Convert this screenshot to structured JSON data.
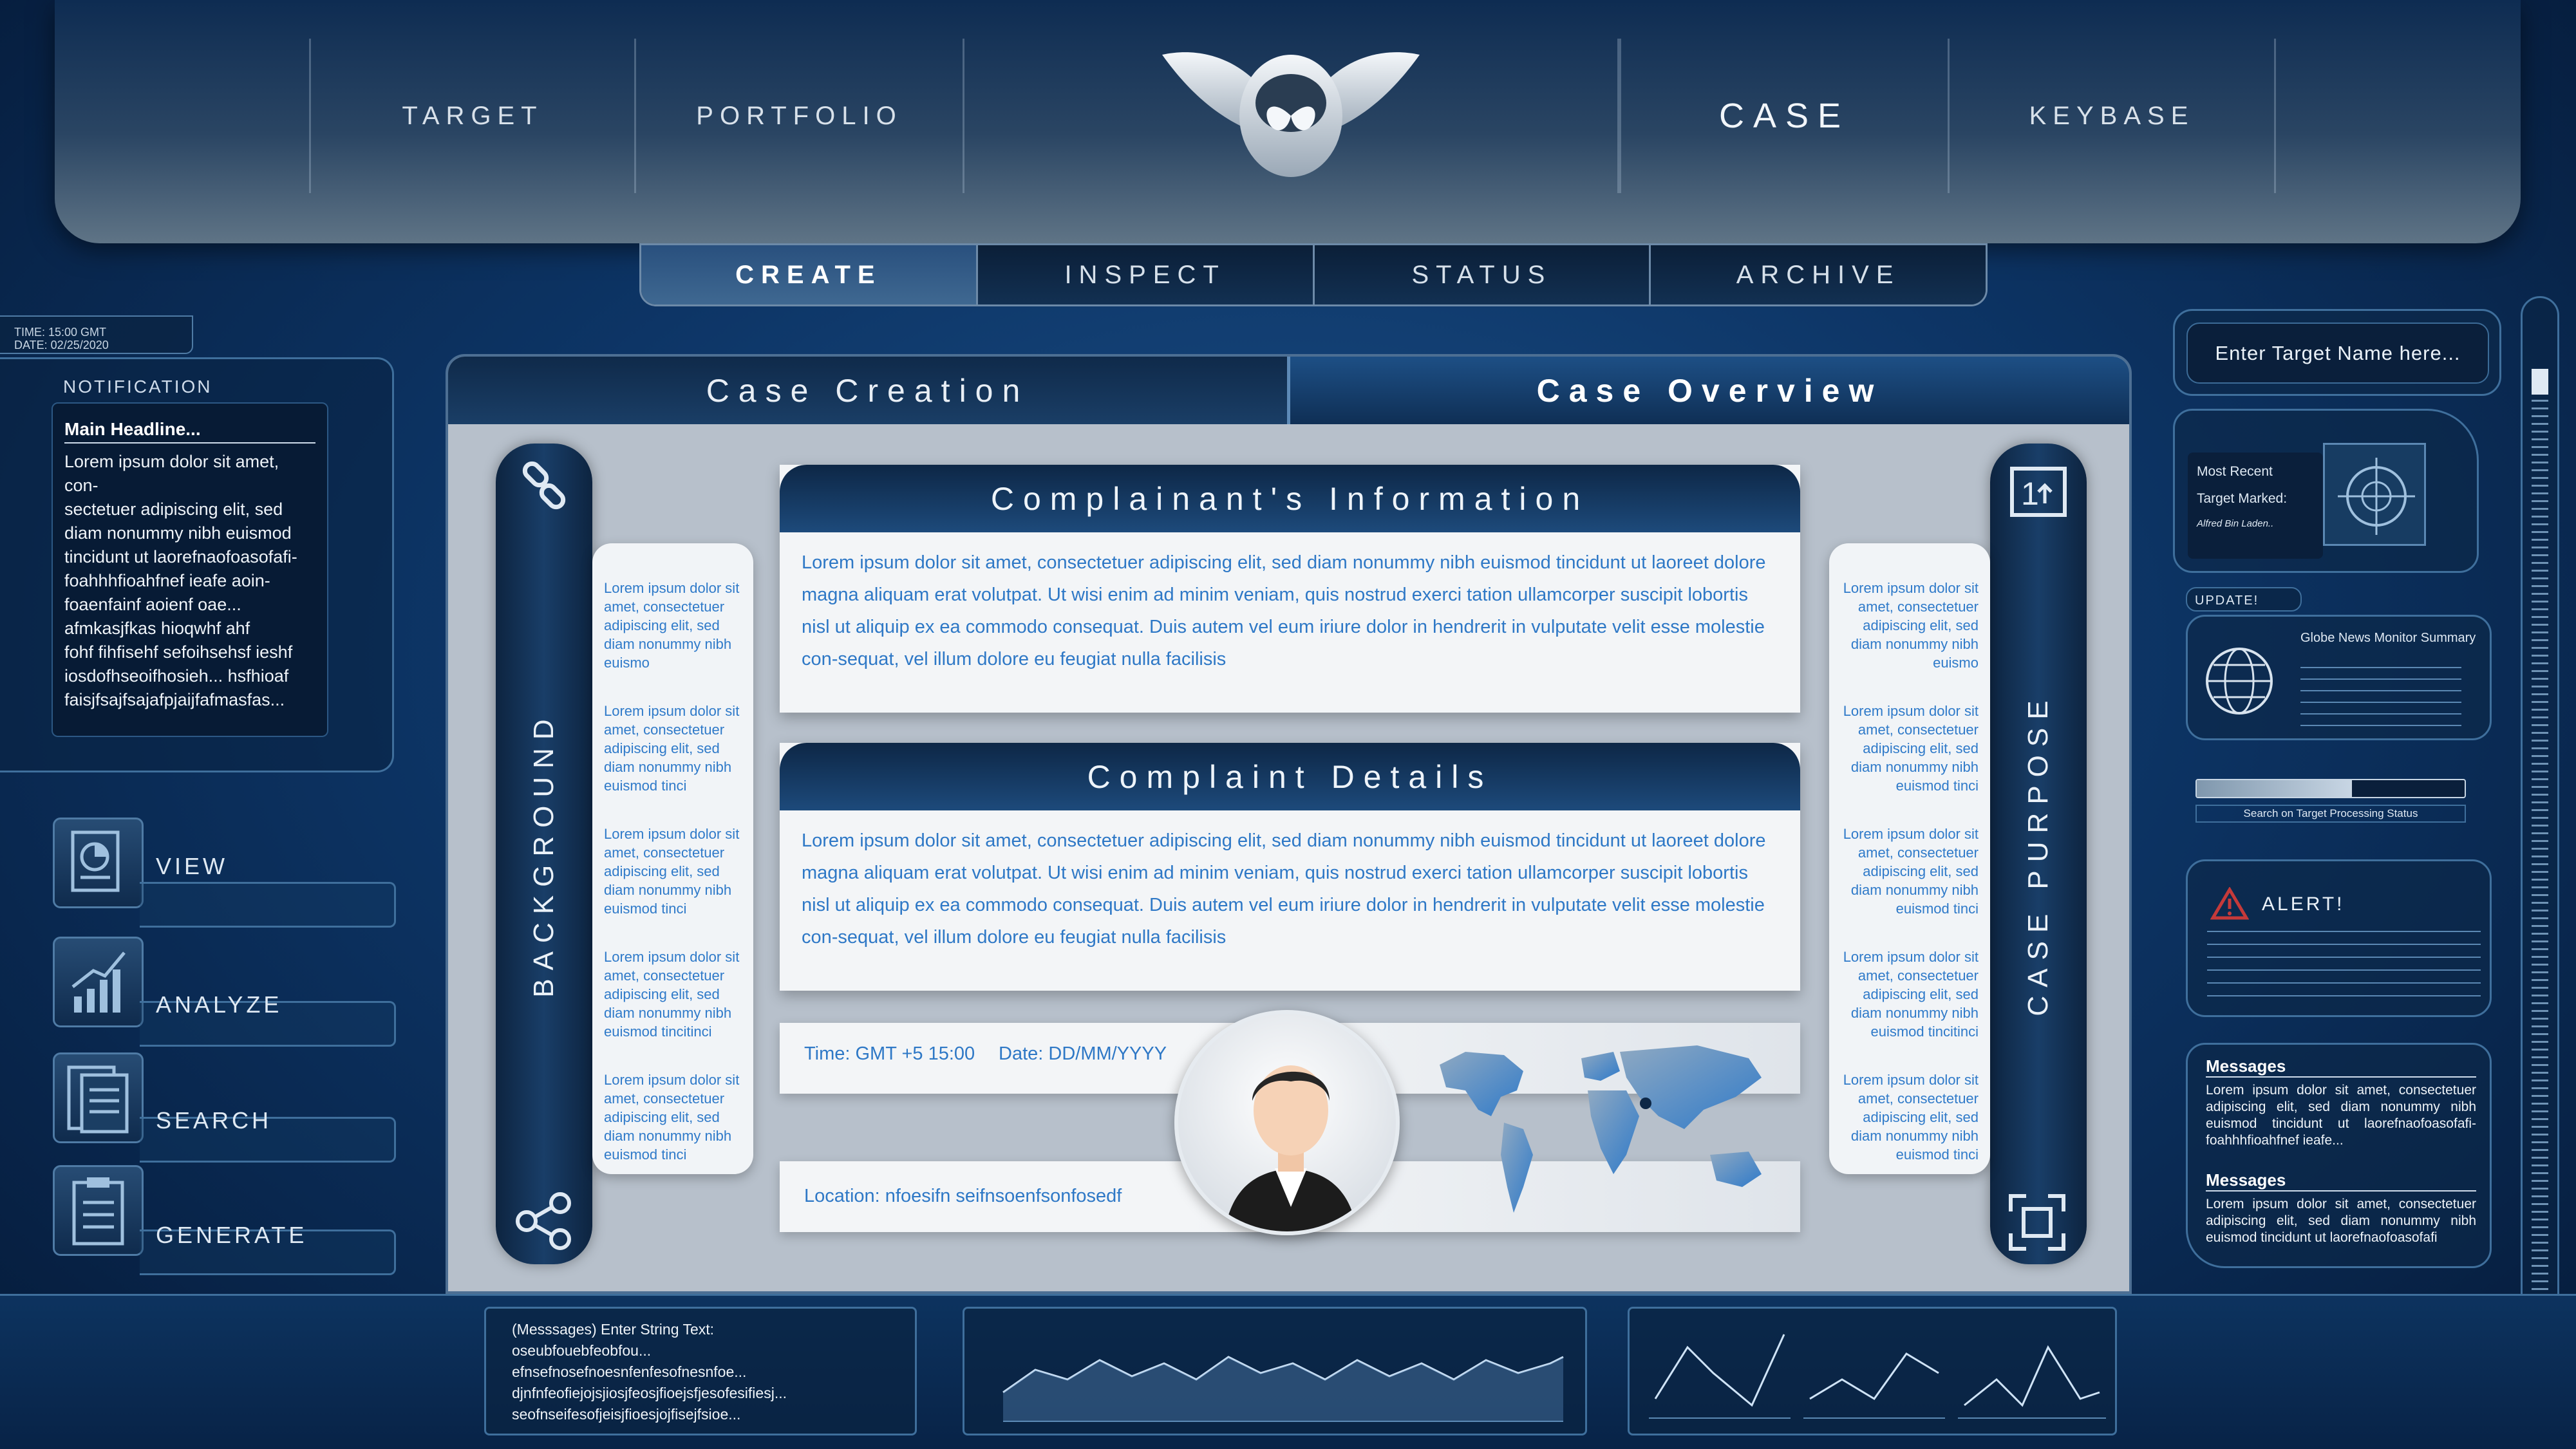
{
  "top_nav": {
    "items": [
      "TARGET",
      "PORTFOLIO",
      "CASE",
      "KEYBASE"
    ],
    "logo": "winged-owl-logo"
  },
  "sub_tabs": {
    "create": "CREATE",
    "inspect": "INSPECT",
    "status": "STATUS",
    "archive": "ARCHIVE",
    "active": "CREATE"
  },
  "time_box": {
    "time": "TIME: 15:00 GMT",
    "date": "DATE: 02/25/2020"
  },
  "notification": {
    "title": "NOTIFICATION",
    "headline": "Main Headline...",
    "lines": [
      "Lorem ipsum dolor sit amet, con-",
      "sectetuer adipiscing elit, sed",
      "diam nonummy nibh euismod",
      "tincidunt ut laorefnaofoasofafi-",
      "foahhhfioahfnef ieafe aoin-",
      "foaenfainf aoienf oae...",
      "afmkasjfkas hioqwhf ahf",
      "fohf fihfisehf sefoihsehsf ieshf",
      "iosdofhseoifhosieh... hsfhioaf",
      "faisjfsajfsajafpjaijfafmasfas..."
    ]
  },
  "left_actions": {
    "view": "VIEW",
    "analyze": "ANALYZE",
    "search": "SEARCH",
    "generate": "GENERATE"
  },
  "panel_tabs": {
    "creation": "Case Creation",
    "overview": "Case Overview",
    "active": "Case Overview"
  },
  "side_labels": {
    "left": "BACKGROUND",
    "right": "CASE PURPOSE"
  },
  "lorem_left": [
    "Lorem ipsum dolor sit amet, consectetuer adipiscing elit, sed diam nonummy nibh euismo",
    "Lorem ipsum dolor sit amet, consectetuer adipiscing elit, sed diam nonummy nibh euismod tinci",
    "Lorem ipsum dolor sit amet, consectetuer adipiscing elit, sed diam nonummy nibh euismod tinci",
    "Lorem ipsum dolor sit amet, consectetuer adipiscing elit, sed diam nonummy nibh euismod tincitinci",
    "Lorem ipsum dolor sit amet, consectetuer adipiscing elit, sed diam nonummy nibh euismod tinci"
  ],
  "lorem_right": [
    "Lorem ipsum dolor sit amet, consectetuer adipiscing elit, sed diam nonummy nibh euismo",
    "Lorem ipsum dolor sit amet, consectetuer adipiscing elit, sed diam nonummy nibh euismod tinci",
    "Lorem ipsum dolor sit amet, consectetuer adipiscing elit, sed diam nonummy nibh euismod tinci",
    "Lorem ipsum dolor sit amet, consectetuer adipiscing elit, sed diam nonummy nibh euismod tincitinci",
    "Lorem ipsum dolor sit amet, consectetuer adipiscing elit, sed diam nonummy nibh euismod tinci"
  ],
  "complainant": {
    "title": "Complainant's Information",
    "body": "Lorem ipsum dolor sit amet, consectetuer adipiscing elit, sed diam nonummy nibh euismod tincidunt ut laoreet dolore magna aliquam erat volutpat. Ut wisi enim ad minim veniam, quis nostrud exerci tation ullamcorper suscipit lobortis nisl ut aliquip ex ea commodo consequat. Duis autem vel eum iriure dolor in hendrerit in vulputate velit esse molestie con-sequat, vel illum dolore eu feugiat nulla facilisis"
  },
  "complaint": {
    "title": "Complaint Details",
    "body": "Lorem ipsum dolor sit amet, consectetuer adipiscing elit, sed diam nonummy nibh euismod tincidunt ut laoreet dolore magna aliquam erat volutpat. Ut wisi enim ad minim veniam, quis nostrud exerci tation ullamcorper suscipit lobortis nisl ut aliquip ex ea commodo consequat. Duis autem vel eum iriure dolor in hendrerit in vulputate velit esse molestie con-sequat, vel illum dolore eu feugiat nulla facilisis"
  },
  "meta": {
    "time": "Time: GMT +5 15:00",
    "date": "Date: DD/MM/YYYY",
    "location": "Location: nfoesifn seifnsoenfsonfosedf"
  },
  "right_panel": {
    "search_placeholder": "Enter Target Name here...",
    "most_recent": "Most Recent",
    "target_marked": "Target Marked:",
    "target_name": "Alfred Bin Laden..",
    "update": "UPDATE!",
    "globe_title": "Globe News Monitor Summary",
    "processing_label": "Search on Target Processing Status",
    "processing_progress": 0.58,
    "alert": "ALERT!",
    "messages": [
      {
        "title": "Messages",
        "body": "Lorem ipsum dolor sit amet, consectetuer adipiscing elit, sed diam nonummy nibh euismod tincidunt ut laorefnaofoasofafi-foahhhfioahfnef ieafe..."
      },
      {
        "title": "Messages",
        "body": "Lorem ipsum dolor sit amet, consectetuer adipiscing elit, sed diam nonummy nibh euismod tincidunt ut laorefnaofoasofafi"
      }
    ]
  },
  "console": {
    "lines": [
      "(Messsages) Enter String Text:",
      "oseubfouebfeobfou...",
      "efnsefnosefnoesnfenfesofnesnfoe...",
      "djnfnfeofiejojsjiosjfeosjfioejsfjesofesifiesj...",
      "seofnseifesofjeisjfioesjojfisejfsioe..."
    ]
  },
  "colors": {
    "accent": "#2e78c6",
    "panel_dark": "#0d2746",
    "background": "#0d3566"
  }
}
